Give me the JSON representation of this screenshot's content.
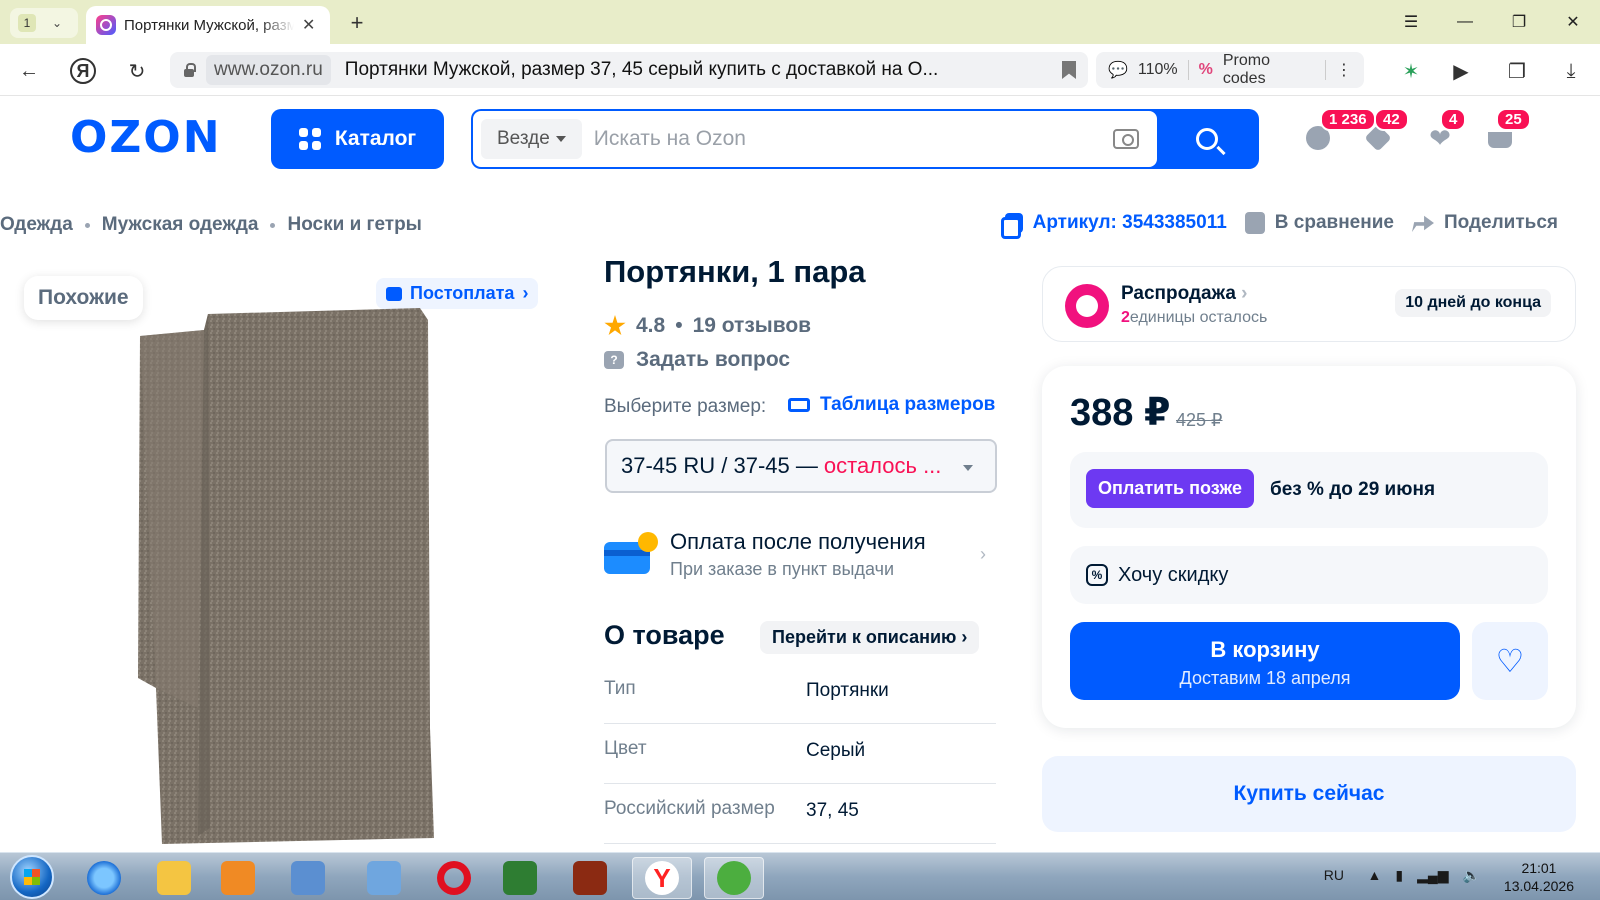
{
  "browser": {
    "tab_count": "1",
    "tab_title": "Портянки Мужской, размер 37, 45 серый купить с доставкой на Ozon",
    "url_domain": "www.ozon.ru",
    "url_title": "Портянки Мужской, размер 37, 45 серый купить с доставкой на О...",
    "zoom": "110%",
    "promo_label": "Promo codes"
  },
  "header": {
    "logo": "OZON",
    "catalog_label": "Каталог",
    "search_scope": "Везде",
    "search_placeholder": "Искать на Ozon",
    "badges": {
      "profile": "1 236",
      "orders": "42",
      "favorites": "4",
      "cart": "25"
    }
  },
  "breadcrumbs": [
    "Одежда",
    "Мужская одежда",
    "Носки и гетры"
  ],
  "meta": {
    "article": "Артикул: 3543385011",
    "compare": "В сравнение",
    "share": "Поделиться"
  },
  "gallery": {
    "similar_label": "Похожие",
    "postpay_label": "Постоплата"
  },
  "product": {
    "title": "Портянки, 1 пара",
    "rating": "4.8",
    "reviews": "19 отзывов",
    "ask_label": "Задать вопрос",
    "size_label": "Выберите размер:",
    "size_table_label": "Таблица размеров",
    "size_value": "37-45 RU / 37-45 —",
    "size_left": "осталось ...",
    "pay_after_title": "Оплата после получения",
    "pay_after_sub": "При заказе в пункт выдачи",
    "about_title": "О товаре",
    "goto_desc": "Перейти к описанию",
    "specs": [
      {
        "key": "Тип",
        "value": "Портянки"
      },
      {
        "key": "Цвет",
        "value": "Серый"
      },
      {
        "key": "Российский размер",
        "value": "37, 45"
      }
    ]
  },
  "sale": {
    "title": "Распродажа",
    "units_num": "2",
    "units_text": "единицы осталось",
    "days_left": "10 дней до конца"
  },
  "buy": {
    "price": "388 ₽",
    "old_price": "425 ₽",
    "pay_later_btn": "Оплатить позже",
    "pay_later_text": "без % до 29 июня",
    "want_discount": "Хочу скидку",
    "cart_label": "В корзину",
    "delivery": "Доставим 18 апреля",
    "buy_now": "Купить сейчас"
  },
  "taskbar": {
    "lang": "RU",
    "time": "21:01",
    "date": "13.04.2026"
  },
  "colors": {
    "ozon_blue": "#005bff",
    "badge_pink": "#f91155",
    "pay_later_purple": "#6d39f2",
    "browser_tabbar": "#e8edc9"
  }
}
